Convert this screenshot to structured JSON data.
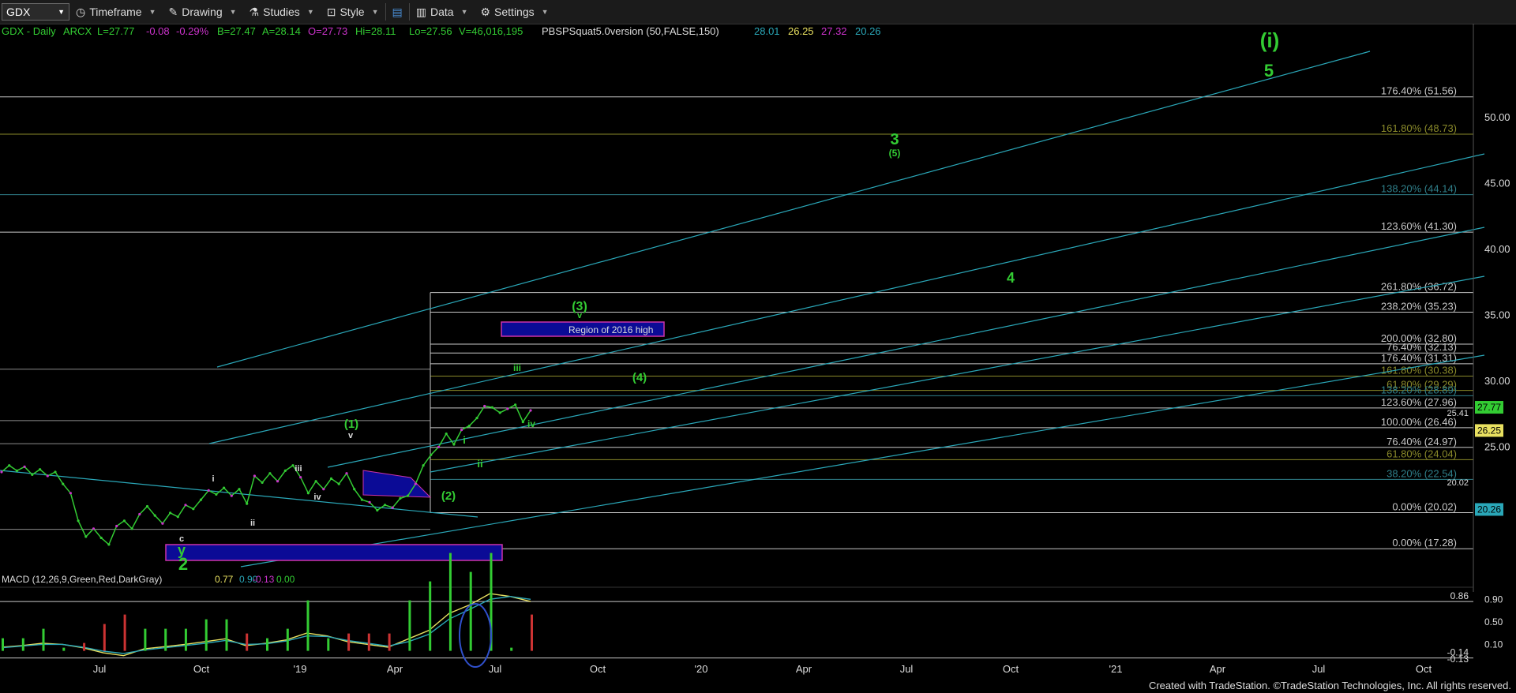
{
  "toolbar": {
    "symbol": "GDX",
    "timeframe": "Timeframe",
    "drawing": "Drawing",
    "studies": "Studies",
    "style": "Style",
    "data": "Data",
    "settings": "Settings"
  },
  "header": {
    "instrument": "GDX - Daily",
    "exchange": "ARCX",
    "last": "L=27.77",
    "change": "-0.08",
    "change_pct": "-0.29%",
    "bid": "B=27.47",
    "ask": "A=28.14",
    "open": "O=27.73",
    "high": "Hi=28.11",
    "low": "Lo=27.56",
    "volume": "V=46,016,195",
    "study": "PBSPSquat5.0version (50,FALSE,150)",
    "study_values": [
      "28.01",
      "26.25",
      "27.32",
      "20.26"
    ]
  },
  "macd_header": {
    "label": "MACD (12,26,9,Green,Red,DarkGray)",
    "values": [
      "0.77",
      "0.90",
      "-0.13",
      "0.00"
    ]
  },
  "footer": "Created with TradeStation. ©TradeStation Technologies, Inc. All rights reserved.",
  "colors": {
    "background": "#000000",
    "price_up": "#33cc33",
    "price_down": "#cc33cc",
    "channel": "#2aa7b8",
    "wave_label": "#33cc33",
    "fib_white": "#c8c8c8",
    "fib_olive": "#8a8a2a",
    "fib_teal": "#2f7f8a",
    "region": "#0b0b96",
    "region_border": "#cc33aa"
  },
  "chart_data": [
    {
      "type": "line",
      "title": "GDX - Daily",
      "price_axis": {
        "ylim": [
          14.0,
          54.0
        ],
        "ticks": [
          "50.00",
          "45.00",
          "40.00",
          "35.00",
          "30.00",
          "25.00"
        ]
      },
      "time_axis": {
        "ticks": [
          "Jul",
          "Oct",
          "'19",
          "Apr",
          "Jul",
          "Oct",
          "'20",
          "Apr",
          "Jul",
          "Oct",
          "'21",
          "Apr",
          "Jul",
          "Oct"
        ]
      },
      "series": [
        {
          "values": [
            23.1,
            23.6,
            23.2,
            23.5,
            22.9,
            23.3,
            22.8,
            23.1,
            22.2,
            21.5,
            19.4,
            18.2,
            18.8,
            18.1,
            17.6,
            19.0,
            19.4,
            18.8,
            19.9,
            20.5,
            19.8,
            19.2,
            20.0,
            19.7,
            20.6,
            20.3,
            21.0,
            21.7,
            21.4,
            21.9,
            21.3,
            21.8,
            20.7,
            22.8,
            22.3,
            23.0,
            22.4,
            23.2,
            23.6,
            22.7,
            21.5,
            22.4,
            21.8,
            22.6,
            22.2,
            23.0,
            21.8,
            21.0,
            20.8,
            20.2,
            20.6,
            20.4,
            21.1,
            21.3,
            22.2,
            23.6,
            24.4,
            25.0,
            26.0,
            25.2,
            26.3,
            26.6,
            27.2,
            28.1,
            28.0,
            27.6,
            27.9,
            28.2,
            26.9,
            27.77
          ]
        }
      ],
      "indicator_lines": [
        {
          "name": "",
          "value": 28.01,
          "label": "27.77"
        },
        {
          "name": "",
          "value": 26.25,
          "label": "26.25"
        },
        {
          "name": "",
          "value": 20.26,
          "label": "20.26"
        }
      ],
      "fib_levels": [
        {
          "label": "176.40% (51.56)",
          "value": 51.56,
          "color": "white"
        },
        {
          "label": "161.80% (48.73)",
          "value": 48.73,
          "color": "olive"
        },
        {
          "label": "138.20% (44.14)",
          "value": 44.14,
          "color": "teal"
        },
        {
          "label": "123.60% (41.30)",
          "value": 41.3,
          "color": "white"
        },
        {
          "label": "261.80% (36.72)",
          "value": 36.72,
          "color": "white"
        },
        {
          "label": "238.20% (35.23)",
          "value": 35.23,
          "color": "white"
        },
        {
          "label": "200.00% (32.80)",
          "value": 32.8,
          "color": "white"
        },
        {
          "label": "76.40% (32.13)",
          "value": 32.13,
          "color": "white"
        },
        {
          "label": "176.40% (31.31)",
          "value": 31.31,
          "color": "white"
        },
        {
          "label": "161.80% (30.38)",
          "value": 30.38,
          "color": "olive"
        },
        {
          "label": "61.80% (29.29)",
          "value": 29.29,
          "color": "olive"
        },
        {
          "label": "138.20% (28.89)",
          "value": 28.89,
          "color": "teal"
        },
        {
          "label": "123.60% (27.96)",
          "value": 27.96,
          "color": "white"
        },
        {
          "label": "100.00% (26.46)",
          "value": 26.46,
          "color": "white"
        },
        {
          "label": "76.40% (24.97)",
          "value": 24.97,
          "color": "white"
        },
        {
          "label": "61.80% (24.04)",
          "value": 24.04,
          "color": "olive"
        },
        {
          "label": "38.20% (22.54)",
          "value": 22.54,
          "color": "teal"
        },
        {
          "label": "0.00% (20.02)",
          "value": 20.02,
          "color": "white"
        },
        {
          "label": "0.00% (17.28)",
          "value": 17.28,
          "color": "white"
        }
      ],
      "annotations": [
        {
          "text": "(i)",
          "color": "green"
        },
        {
          "text": "5",
          "color": "green"
        },
        {
          "text": "3",
          "color": "green"
        },
        {
          "text": "(5)",
          "color": "green"
        },
        {
          "text": "4",
          "color": "green"
        },
        {
          "text": "(3)",
          "color": "green"
        },
        {
          "text": "v",
          "color": "green"
        },
        {
          "text": "(4)",
          "color": "green"
        },
        {
          "text": "Region of 2016 high",
          "color": "white"
        },
        {
          "text": "iii",
          "color": "green"
        },
        {
          "text": "iv",
          "color": "green"
        },
        {
          "text": "i",
          "color": "green"
        },
        {
          "text": "ii",
          "color": "green"
        },
        {
          "text": "(1)",
          "color": "green"
        },
        {
          "text": "v",
          "color": "white"
        },
        {
          "text": "iii",
          "color": "white"
        },
        {
          "text": "iv",
          "color": "white"
        },
        {
          "text": "i",
          "color": "white"
        },
        {
          "text": "ii",
          "color": "white"
        },
        {
          "text": "(2)",
          "color": "green"
        },
        {
          "text": "c",
          "color": "white"
        },
        {
          "text": "y",
          "color": "green"
        },
        {
          "text": "2",
          "color": "green"
        },
        {
          "text": "25.41",
          "color": "white"
        },
        {
          "text": "20.02",
          "color": "white"
        }
      ]
    },
    {
      "type": "bar",
      "title": "MACD (12,26,9,Green,Red,DarkGray)",
      "ylim": [
        -0.3,
        1.1
      ],
      "ticks": [
        "0.90",
        "0.50",
        "0.10"
      ],
      "right_labels": [
        "0.86",
        "-0.14",
        "-0.13"
      ],
      "series": [
        {
          "name": "",
          "values": [
            0.05,
            0.08,
            0.12,
            0.1,
            0.04,
            -0.05,
            -0.1,
            0.02,
            0.06,
            0.1,
            0.15,
            0.2,
            0.08,
            0.12,
            0.18,
            0.3,
            0.25,
            0.15,
            0.1,
            0.05,
            0.2,
            0.35,
            0.65,
            0.8,
            1.0,
            0.95,
            0.86
          ]
        },
        {
          "name": "",
          "values": [
            0.04,
            0.07,
            0.1,
            0.1,
            0.05,
            -0.02,
            -0.06,
            0.0,
            0.04,
            0.08,
            0.12,
            0.17,
            0.1,
            0.11,
            0.16,
            0.25,
            0.24,
            0.17,
            0.12,
            0.07,
            0.15,
            0.28,
            0.55,
            0.72,
            0.9,
            0.95,
            0.9
          ]
        }
      ]
    }
  ]
}
